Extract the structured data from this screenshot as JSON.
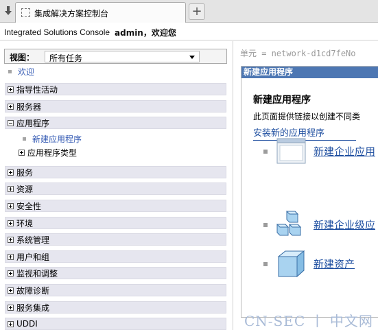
{
  "browser": {
    "tab_title": "集成解决方案控制台",
    "new_tab_symbol": "+"
  },
  "header": {
    "brand": "Integrated Solutions Console",
    "welcome": "admin，欢迎您"
  },
  "nav": {
    "view_label": "视图：",
    "view_value": "所有任务",
    "welcome_link": "欢迎",
    "categories": [
      {
        "label": "指导性活动",
        "expanded": false
      },
      {
        "label": "服务器",
        "expanded": false
      },
      {
        "label": "应用程序",
        "expanded": true
      },
      {
        "label": "服务",
        "expanded": false
      },
      {
        "label": "资源",
        "expanded": false
      },
      {
        "label": "安全性",
        "expanded": false
      },
      {
        "label": "环境",
        "expanded": false
      },
      {
        "label": "系统管理",
        "expanded": false
      },
      {
        "label": "用户和组",
        "expanded": false
      },
      {
        "label": "监视和调整",
        "expanded": false
      },
      {
        "label": "故障诊断",
        "expanded": false
      },
      {
        "label": "服务集成",
        "expanded": false
      },
      {
        "label": "UDDI",
        "expanded": false
      }
    ],
    "app_children": {
      "new_app": "新建应用程序",
      "app_types": "应用程序类型"
    }
  },
  "content": {
    "cell": "单元 = network-d1cd7feNo",
    "panel_title": "新建应用程序",
    "heading": "新建应用程序",
    "description": "此页面提供链接以创建不同类",
    "install_link": "安装新的应用程序",
    "options": [
      {
        "label": "新建企业应用",
        "icon": "enterprise-app-window-icon"
      },
      {
        "label": "新建企业级应",
        "icon": "cubes-icon"
      },
      {
        "label": "新建资产",
        "icon": "cube-icon"
      }
    ]
  },
  "watermark": "CN-SEC 丨 中文网",
  "colors": {
    "panel_title_bg": "#4d77b3",
    "link": "#1f4fa0",
    "nav_category_bg": "#e6e6ef"
  }
}
